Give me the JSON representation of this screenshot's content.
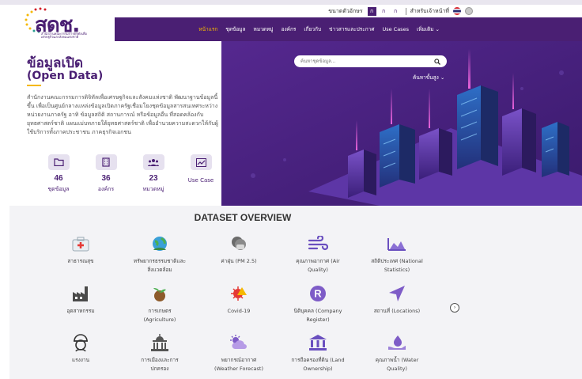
{
  "logo": {
    "text": "สดช.",
    "subtitle": "สำนักงานคณะกรรมการดิจิทัลเพื่อเศรษฐกิจและสังคมแห่งชาติ"
  },
  "util": {
    "font_size_label": "ขนาดตัวอักษร",
    "font_sizes": [
      "ก",
      "ก",
      "ก"
    ],
    "accessibility_label": "สำหรับเจ้าหน้าที่"
  },
  "nav": {
    "items": [
      "หน้าแรก",
      "ชุดข้อมูล",
      "หมวดหมู่",
      "องค์กร",
      "เกี่ยวกับ",
      "ข่าวสารและประกาศ",
      "Use Cases",
      "เพิ่มเติม ⌄"
    ]
  },
  "hero": {
    "title": "ข้อมูลเปิด",
    "subtitle": "(Open Data)",
    "description": "สำนักงานคณะกรรมการดิจิทัลเพื่อเศรษฐกิจและสังคมแห่งชาติ พัฒนาฐานข้อมูลนี้ขึ้น เพื่อเป็นศูนย์กลางแหล่งข้อมูลเปิดภาครัฐเชื่อมโยงชุดข้อมูลสารสนเทศระหว่างหน่วยงานภาครัฐ อาทิ ข้อมูลสถิติ สถานการณ์ หรือข้อมูลอื่น ที่สอดคล้องกับยุทธศาสตร์ชาติ แผนแม่บทภายใต้ยุทธศาสตร์ชาติ เพื่ออำนวยความสะดวกให้กับผู้ใช้บริการทั้งภาคประชาชน ภาคธุรกิจเอกชน",
    "search_placeholder": "ค้นหาชุดข้อมูล...",
    "advanced_search": "ค้นหาขั้นสูง ⌄",
    "stats": [
      {
        "icon": "folder-icon",
        "value": "46",
        "label": "ชุดข้อมูล"
      },
      {
        "icon": "building-icon",
        "value": "36",
        "label": "องค์กร"
      },
      {
        "icon": "users-icon",
        "value": "23",
        "label": "หมวดหมู่"
      },
      {
        "icon": "chart-icon",
        "value": "",
        "label": "Use Case"
      }
    ]
  },
  "overview": {
    "title": "DATASET OVERVIEW",
    "categories": [
      {
        "icon": "first-aid-icon",
        "line1": "สาธารณสุข",
        "line2": ""
      },
      {
        "icon": "globe-plant-icon",
        "line1": "ทรัพยากรธรรมชาติและ",
        "line2": "สิ่งแวดล้อม"
      },
      {
        "icon": "mask-icon",
        "line1": "ค่าฝุ่น (PM 2.5)",
        "line2": ""
      },
      {
        "icon": "wind-icon",
        "line1": "คุณภาพอากาศ (Air",
        "line2": "Quality)"
      },
      {
        "icon": "area-chart-icon",
        "line1": "สถิติประเทศ (National",
        "line2": "Statistics)"
      },
      {
        "icon": "factory-icon",
        "line1": "อุตสาหกรรม",
        "line2": ""
      },
      {
        "icon": "sprout-icon",
        "line1": "การเกษตร",
        "line2": "(Agriculture)"
      },
      {
        "icon": "virus-icon",
        "line1": "Covid-19",
        "line2": ""
      },
      {
        "icon": "registered-icon",
        "line1": "นิติบุคคล (Company",
        "line2": "Register)"
      },
      {
        "icon": "location-arrow-icon",
        "line1": "สถานที่ (Locations)",
        "line2": ""
      },
      {
        "icon": "worker-helmet-icon",
        "line1": "แรงงาน",
        "line2": ""
      },
      {
        "icon": "capitol-icon",
        "line1": "การเมืองและการ",
        "line2": "ปกครอง"
      },
      {
        "icon": "weather-icon",
        "line1": "พยากรณ์อากาศ",
        "line2": "(Weather Forecast)"
      },
      {
        "icon": "land-icon",
        "line1": "การถือครองที่ดิน (Land",
        "line2": "Ownership)"
      },
      {
        "icon": "water-drop-icon",
        "line1": "คุณภาพน้ำ (Water",
        "line2": "Quality)"
      }
    ]
  },
  "colors": {
    "brand": "#4a1f73",
    "accent": "#f5b800",
    "hero_bg": "#4c2584"
  }
}
